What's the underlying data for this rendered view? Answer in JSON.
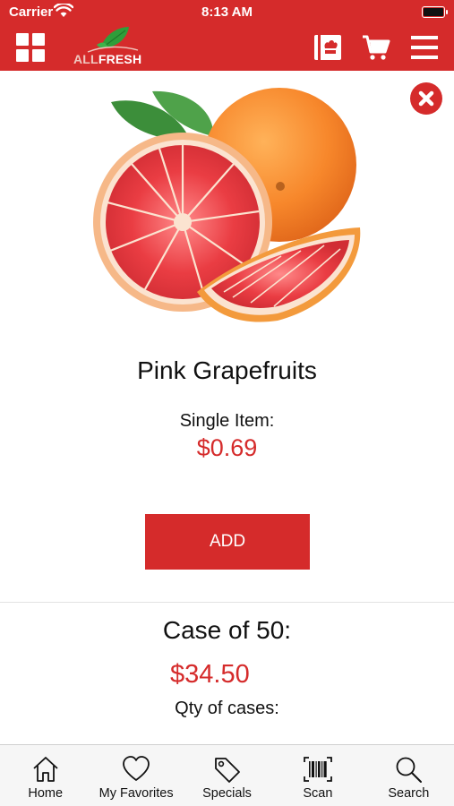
{
  "status_bar": {
    "carrier": "Carrier",
    "time": "8:13 AM"
  },
  "header": {
    "logo_prefix": "ALL",
    "logo_brand": "FRESH",
    "icons": [
      "grid-icon",
      "recipe-book-icon",
      "cart-icon",
      "hamburger-menu-icon"
    ]
  },
  "product": {
    "name": "Pink Grapefruits",
    "single_label": "Single Item:",
    "single_price": "$0.69",
    "add_label": "ADD",
    "case_label": "Case of 50:",
    "case_price": "$34.50",
    "qty_label": "Qty of cases:"
  },
  "tabbar": {
    "items": [
      {
        "label": "Home",
        "icon": "home-icon"
      },
      {
        "label": "My Favorites",
        "icon": "heart-icon"
      },
      {
        "label": "Specials",
        "icon": "tag-icon"
      },
      {
        "label": "Scan",
        "icon": "barcode-icon"
      },
      {
        "label": "Search",
        "icon": "search-icon"
      }
    ]
  },
  "colors": {
    "brand_red": "#d52b2b",
    "tabbar_bg": "#f6f6f6"
  }
}
